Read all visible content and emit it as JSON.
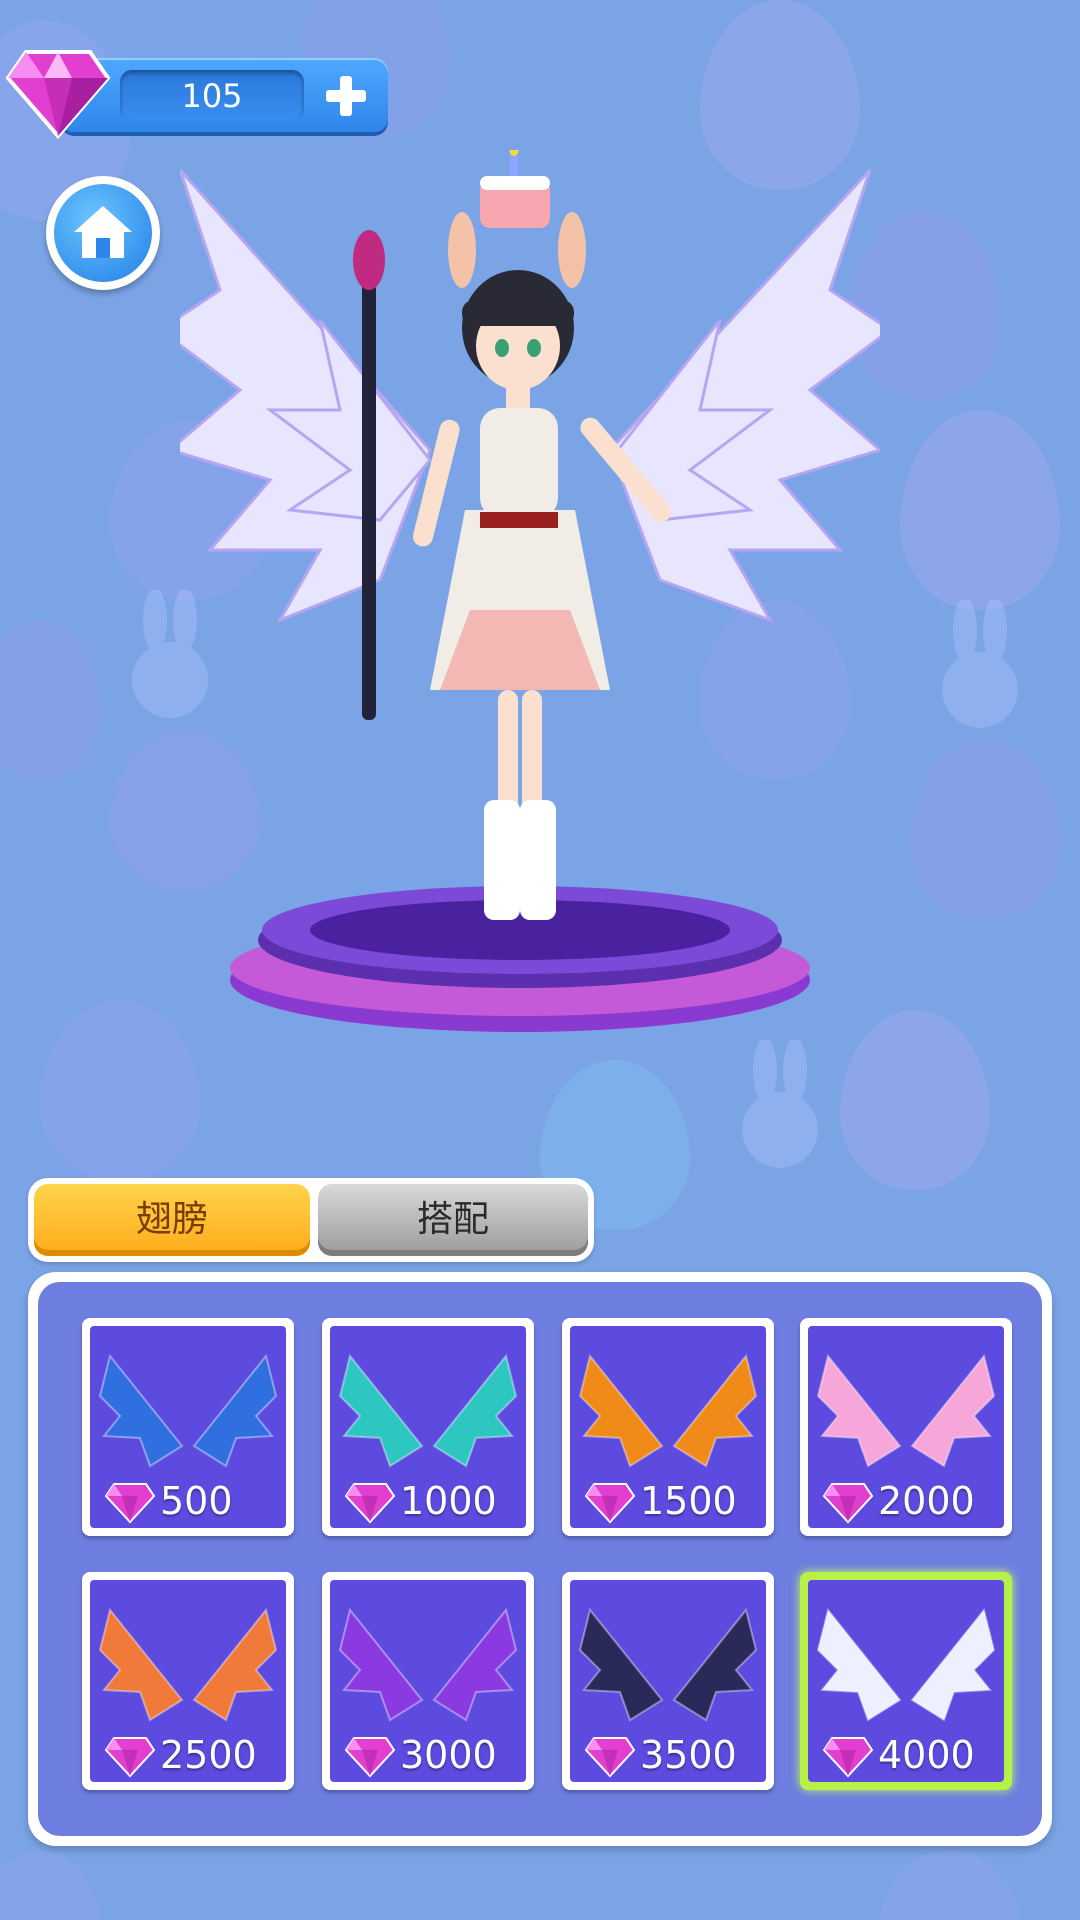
{
  "currency": {
    "gems": "105",
    "gem_icon": "pink-diamond-icon",
    "add_icon": "plus-icon"
  },
  "home": {
    "icon": "home-icon"
  },
  "tabs": [
    {
      "label": "翅膀",
      "active": true
    },
    {
      "label": "搭配",
      "active": false
    }
  ],
  "shop": {
    "items": [
      {
        "price": "500",
        "icon": "blue-flower-wings-icon",
        "color": "#2f6fe0"
      },
      {
        "price": "1000",
        "icon": "teal-feather-wings-icon",
        "color": "#2ec6c0"
      },
      {
        "price": "1500",
        "icon": "fire-wings-icon",
        "color": "#f08a18"
      },
      {
        "price": "2000",
        "icon": "pink-angel-wings-icon",
        "color": "#f6a6d8"
      },
      {
        "price": "2500",
        "icon": "dragon-wings-icon",
        "color": "#f07a3a"
      },
      {
        "price": "3000",
        "icon": "purple-butterfly-wings-icon",
        "color": "#8a3ae0"
      },
      {
        "price": "3500",
        "icon": "dark-demon-wings-icon",
        "color": "#2a2a5a"
      },
      {
        "price": "4000",
        "icon": "white-angel-wings-icon",
        "color": "#eef0ff",
        "selected": true
      }
    ]
  },
  "colors": {
    "background": "#7aa4e6",
    "panel": "#6d7de0",
    "card": "#5d4be0",
    "tab_active": "#ffc233",
    "selected": "#b8f04a"
  }
}
